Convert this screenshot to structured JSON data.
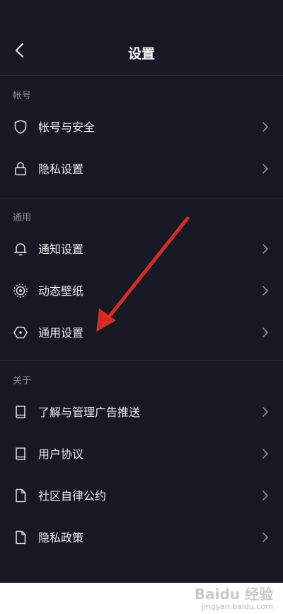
{
  "header": {
    "title": "设置"
  },
  "sections": {
    "account": {
      "label": "帐号",
      "items": [
        {
          "label": "帐号与安全",
          "icon": "shield-icon"
        },
        {
          "label": "隐私设置",
          "icon": "lock-icon"
        }
      ]
    },
    "general": {
      "label": "通用",
      "items": [
        {
          "label": "通知设置",
          "icon": "bell-icon"
        },
        {
          "label": "动态壁纸",
          "icon": "live-wallpaper-icon"
        },
        {
          "label": "通用设置",
          "icon": "hexagon-icon"
        }
      ]
    },
    "about": {
      "label": "关于",
      "items": [
        {
          "label": "了解与管理广告推送",
          "icon": "book-icon"
        },
        {
          "label": "用户协议",
          "icon": "book-icon"
        },
        {
          "label": "社区自律公约",
          "icon": "document-icon"
        },
        {
          "label": "隐私政策",
          "icon": "document-icon"
        }
      ]
    }
  },
  "watermark": {
    "brand": "Baidu 经验",
    "url": "jingyan.baidu.com"
  },
  "colors": {
    "background": "#161823",
    "divider": "#262936",
    "text": "#e8e9ec",
    "section_label": "#8a8b93",
    "annotation_arrow": "#d62b22"
  }
}
